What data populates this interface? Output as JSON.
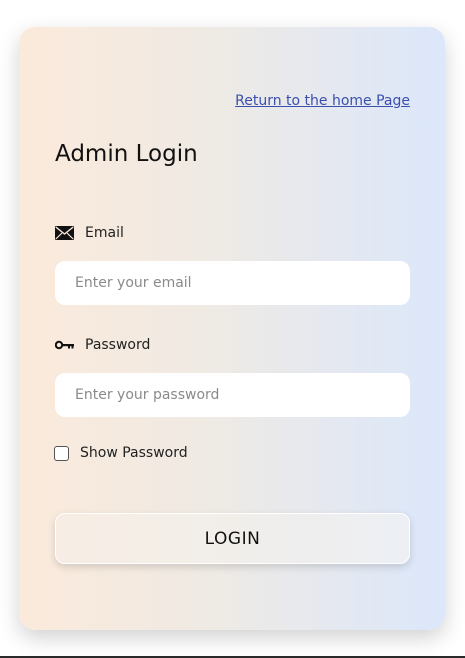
{
  "header": {
    "home_link": "Return to the home Page",
    "title": "Admin Login"
  },
  "form": {
    "email": {
      "label": "Email",
      "icon": "envelope-icon",
      "placeholder": "Enter your email",
      "value": ""
    },
    "password": {
      "label": "Password",
      "icon": "key-icon",
      "placeholder": "Enter your password",
      "value": ""
    },
    "show_password": {
      "label": "Show Password",
      "checked": false
    },
    "submit_label": "LOGIN"
  },
  "colors": {
    "link": "#3b4fae",
    "gradient_left": "#fbeadb",
    "gradient_right": "#dbe7fb"
  }
}
